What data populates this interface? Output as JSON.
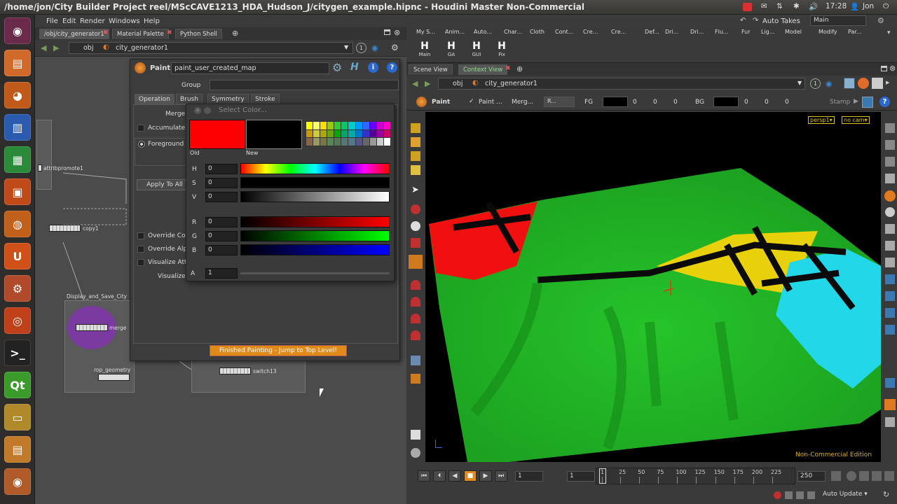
{
  "window": {
    "title": "/home/jon/City Builder Project reel/MScCAVE1213_HDA_Hudson_J/citygen_example.hipnc - Houdini Master Non-Commercial"
  },
  "tray": {
    "time": "17:28",
    "user": "Jon",
    "auto_takes": "Auto Takes",
    "desk": "Main"
  },
  "menu": [
    "File",
    "Edit",
    "Render",
    "Windows",
    "Help"
  ],
  "network": {
    "tabs": [
      "/obj/city_generator1",
      "Material Palette",
      "Python Shell"
    ],
    "path_root": "obj",
    "path_node": "city_generator1",
    "nodes": {
      "attribpromote": "attribpromote1",
      "copy": "copy1",
      "group_box": "Display_and_Save_City",
      "merge": "merge",
      "rop": "rop_geometry",
      "switch": "switch13"
    }
  },
  "paint": {
    "title": "Paint",
    "name_value": "paint_user_created_map",
    "group_label": "Group",
    "tabs": [
      "Operation",
      "Brush",
      "Symmetry",
      "Stroke"
    ],
    "merge_label": "Merge",
    "accumulate_label": "Accumulate",
    "foreground_label": "Foreground",
    "apply_all": "Apply To All",
    "override_color": "Override Co",
    "override_alpha": "Override Alp",
    "visualize_att": "Visualize Att",
    "visualize": "Visualize",
    "finish": "Finished Painting - Jump to Top Level!"
  },
  "color_dialog": {
    "title": "Select Color...",
    "old_label": "Old",
    "new_label": "New",
    "old_color": "#ff0000",
    "new_color": "#000000",
    "fields": [
      {
        "label": "H",
        "value": "0"
      },
      {
        "label": "S",
        "value": "0"
      },
      {
        "label": "V",
        "value": "0"
      },
      {
        "label": "R",
        "value": "0"
      },
      {
        "label": "G",
        "value": "0"
      },
      {
        "label": "B",
        "value": "0"
      },
      {
        "label": "A",
        "value": "1"
      }
    ]
  },
  "shelf": {
    "tabs": [
      "My S...",
      "Anim...",
      "Auto...",
      "Char...",
      "Cloth",
      "Cont...",
      "Cre...",
      "Cre...",
      "Def...",
      "Dri...",
      "Dri...",
      "Flu...",
      "Fur",
      "Lig...",
      "Model",
      "Modify",
      "Par..."
    ],
    "tools": [
      {
        "icon": "H",
        "label": "Main"
      },
      {
        "icon": "H",
        "label": "GA"
      },
      {
        "icon": "H",
        "label": "GUI"
      },
      {
        "icon": "H",
        "label": "Fix"
      }
    ]
  },
  "viewer": {
    "tabs": [
      "Scene View",
      "Context View"
    ],
    "path_root": "obj",
    "path_node": "city_generator1",
    "toolbar": {
      "paint": "Paint",
      "paint_check": "Paint ...",
      "merge": "Merg...",
      "mode": "R...",
      "fg": "FG",
      "fg_values": [
        "0",
        "0",
        "0"
      ],
      "bg": "BG",
      "bg_values": [
        "0",
        "0",
        "0"
      ],
      "stamp": "Stamp"
    },
    "camera": "persp1",
    "cam_menu": "no cam",
    "watermark": "Non-Commercial Edition"
  },
  "timeline": {
    "frame": "1",
    "start": "1",
    "ticks": [
      "1",
      "25",
      "50",
      "75",
      "100",
      "125",
      "150",
      "175",
      "200",
      "225"
    ],
    "end": "250"
  },
  "status": {
    "auto_update": "Auto Update"
  }
}
